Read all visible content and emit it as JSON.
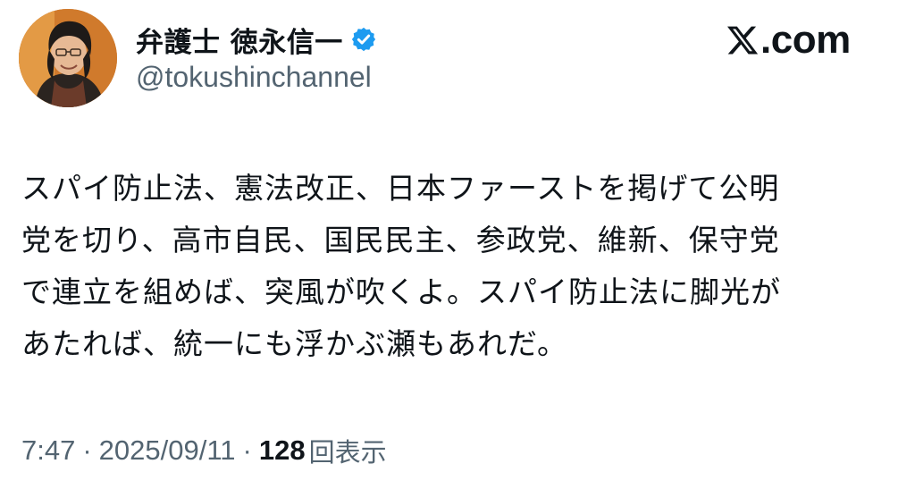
{
  "author": {
    "display_name": "弁護士 徳永信一",
    "handle": "@tokushinchannel",
    "verified": true,
    "avatar_icon": "avatar-photo",
    "verified_icon": "verified-badge-icon",
    "verified_color": "#1d9bf0"
  },
  "brand": {
    "logo_icon": "x-logo-icon",
    "domain": ".com"
  },
  "post": {
    "text": "スパイ防止法、憲法改正、日本ファーストを掲げて公明\n党を切り、高市自民、国民民主、参政党、維新、保守党\nで連立を組めば、突風が吹くよ。スパイ防止法に脚光が\nあたれば、統一にも浮かぶ瀬もあれだ。"
  },
  "meta": {
    "time": "7:47",
    "separator": "·",
    "date": "2025/09/11",
    "views_count": "128",
    "views_label": "回表示"
  },
  "colors": {
    "text_primary": "#0f1419",
    "text_secondary": "#536471",
    "background": "#ffffff"
  }
}
